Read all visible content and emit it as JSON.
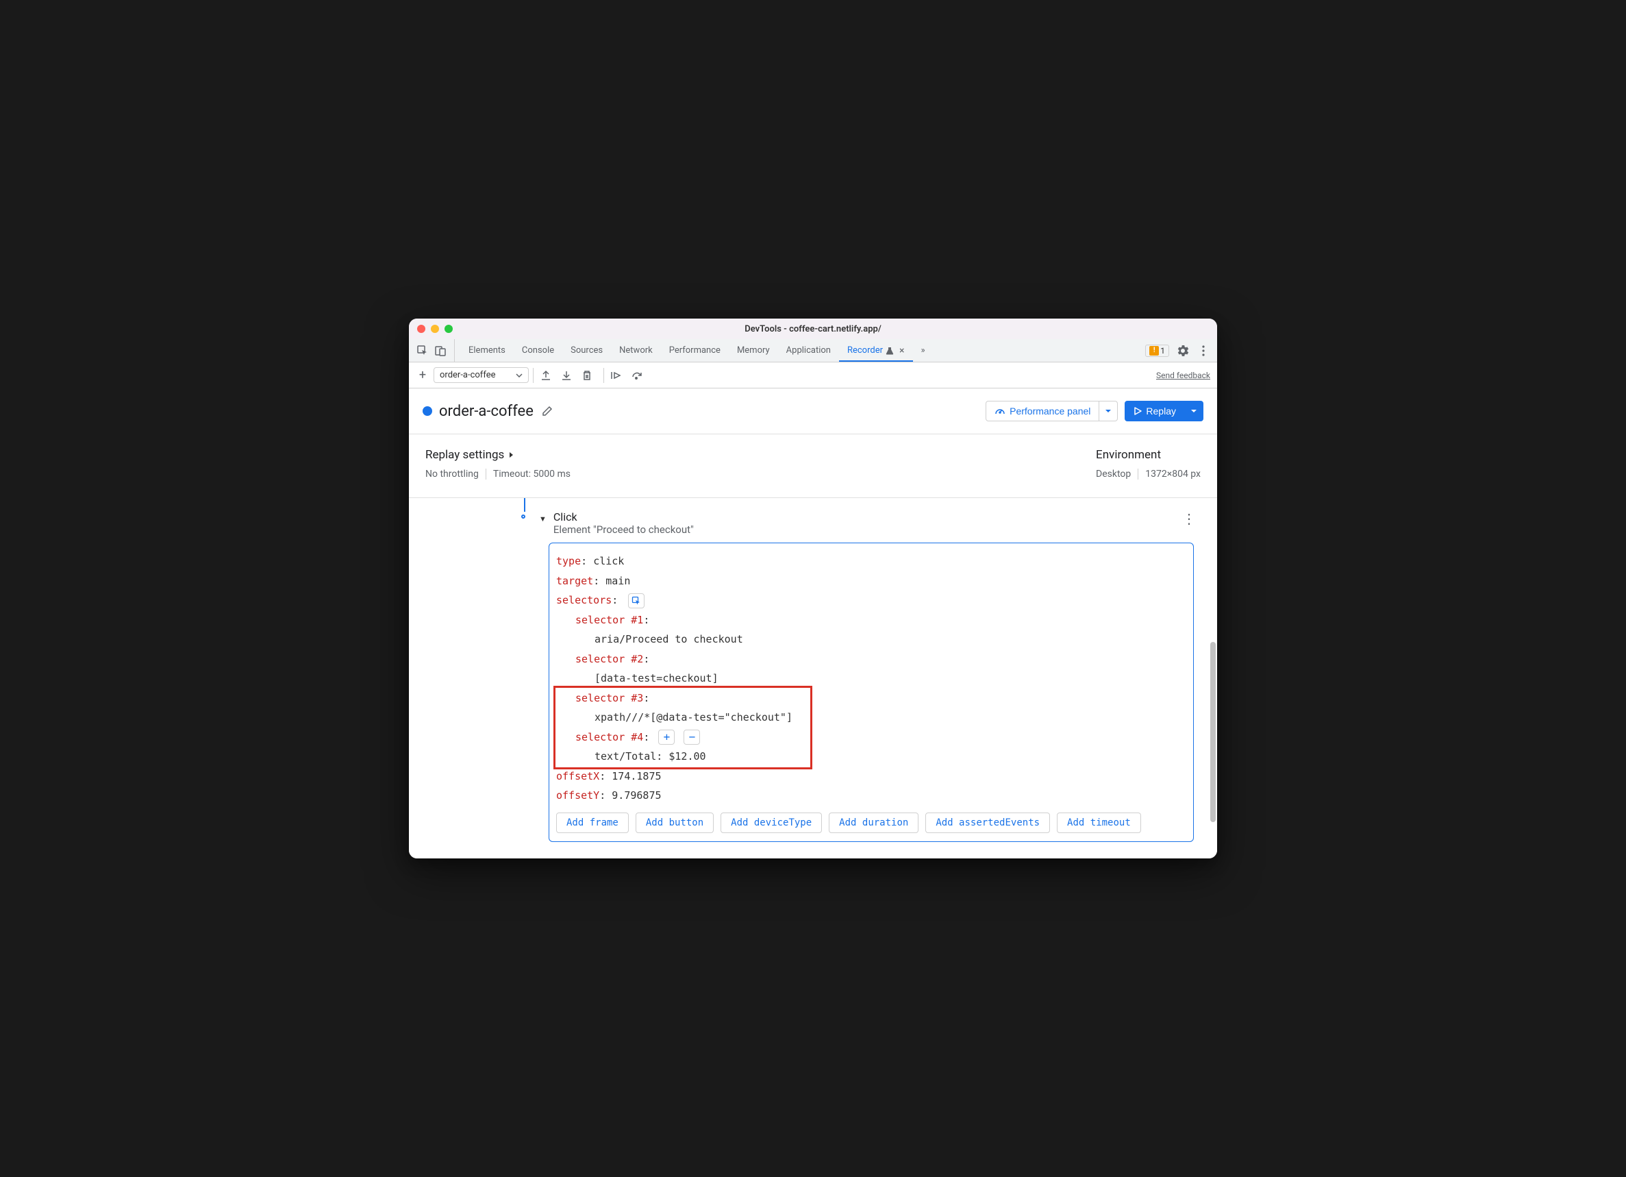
{
  "window": {
    "title": "DevTools - coffee-cart.netlify.app/"
  },
  "tabs": {
    "elements": "Elements",
    "console": "Console",
    "sources": "Sources",
    "network": "Network",
    "performance": "Performance",
    "memory": "Memory",
    "application": "Application",
    "recorder": "Recorder",
    "more": "»"
  },
  "warnings": {
    "count": "1"
  },
  "toolbar": {
    "recording_name": "order-a-coffee",
    "send_feedback": "Send feedback"
  },
  "header": {
    "recording_title": "order-a-coffee",
    "performance_btn": "Performance panel",
    "replay_btn": "Replay"
  },
  "settings": {
    "replay_title": "Replay settings",
    "no_throttling": "No throttling",
    "timeout": "Timeout: 5000 ms",
    "environment_title": "Environment",
    "device": "Desktop",
    "dimensions": "1372×804 px"
  },
  "step": {
    "title": "Click",
    "subtitle": "Element \"Proceed to checkout\"",
    "type_key": "type",
    "type_val": "click",
    "target_key": "target",
    "target_val": "main",
    "selectors_key": "selectors",
    "sel1_key": "selector #1",
    "sel1_val": "aria/Proceed to checkout",
    "sel2_key": "selector #2",
    "sel2_val": "[data-test=checkout]",
    "sel3_key": "selector #3",
    "sel3_val": "xpath///*[@data-test=\"checkout\"]",
    "sel4_key": "selector #4",
    "sel4_val": "text/Total: $12.00",
    "offsetx_key": "offsetX",
    "offsetx_val": "174.1875",
    "offsety_key": "offsetY",
    "offsety_val": "9.796875"
  },
  "add_buttons": {
    "frame": "Add frame",
    "button": "Add button",
    "deviceType": "Add deviceType",
    "duration": "Add duration",
    "assertedEvents": "Add assertedEvents",
    "timeout": "Add timeout"
  }
}
